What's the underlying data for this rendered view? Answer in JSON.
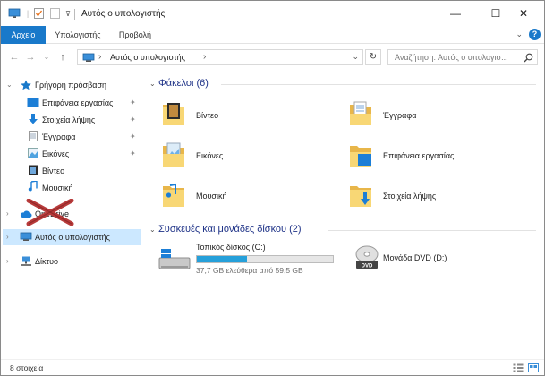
{
  "window": {
    "title": "Αυτός ο υπολογιστής",
    "minimize": "—",
    "maximize": "☐",
    "close": "✕"
  },
  "ribbon": {
    "tabs": [
      "Αρχείο",
      "Υπολογιστής",
      "Προβολή"
    ],
    "active_tab": "Αρχείο",
    "collapse": "⌄",
    "help": "?"
  },
  "address": {
    "back": "←",
    "forward": "→",
    "recent": "⌄",
    "up": "↑",
    "path_sep": "›",
    "path": "Αυτός ο υπολογιστής",
    "path_arrow": "›",
    "dropdown": "⌄",
    "refresh": "↻",
    "search_placeholder": "Αναζήτηση: Αυτός ο υπολογισ..."
  },
  "nav": {
    "quick_access": "Γρήγορη πρόσβαση",
    "quick_items": [
      {
        "label": "Επιφάνεια εργασίας",
        "icon": "desktop-icon",
        "pinned": true
      },
      {
        "label": "Στοιχεία λήψης",
        "icon": "download-icon",
        "pinned": true
      },
      {
        "label": "Έγγραφα",
        "icon": "documents-icon",
        "pinned": true
      },
      {
        "label": "Εικόνες",
        "icon": "pictures-icon",
        "pinned": true
      },
      {
        "label": "Βίντεο",
        "icon": "video-icon",
        "pinned": false
      },
      {
        "label": "Μουσική",
        "icon": "music-icon",
        "pinned": false
      }
    ],
    "onedrive_label": "OneDrive",
    "this_pc": "Αυτός ο υπολογιστής",
    "network": "Δίκτυο",
    "pin_glyph": "✦"
  },
  "content": {
    "folders_header": "Φάκελοι (6)",
    "folders": [
      {
        "label": "Βίντεο",
        "icon": "video-folder-icon"
      },
      {
        "label": "Έγγραφα",
        "icon": "documents-folder-icon"
      },
      {
        "label": "Εικόνες",
        "icon": "pictures-folder-icon"
      },
      {
        "label": "Επιφάνεια εργασίας",
        "icon": "desktop-folder-icon"
      },
      {
        "label": "Μουσική",
        "icon": "music-folder-icon"
      },
      {
        "label": "Στοιχεία λήψης",
        "icon": "downloads-folder-icon"
      }
    ],
    "devices_header": "Συσκευές και μονάδες δίσκου (2)",
    "drives": [
      {
        "label": "Τοπικός δίσκος (C:)",
        "free": "37,7 GB ελεύθερα από 59,5 GB",
        "used_fraction": 0.366
      },
      {
        "label": "Μονάδα DVD (D:)",
        "badge": "DVD"
      }
    ]
  },
  "status": {
    "count": "8 στοιχεία"
  },
  "colors": {
    "accent": "#1979ca",
    "selection": "#cce8ff",
    "group_header": "#1e3287",
    "folder": "#f8d775",
    "drive_fill": "#26a0da"
  }
}
